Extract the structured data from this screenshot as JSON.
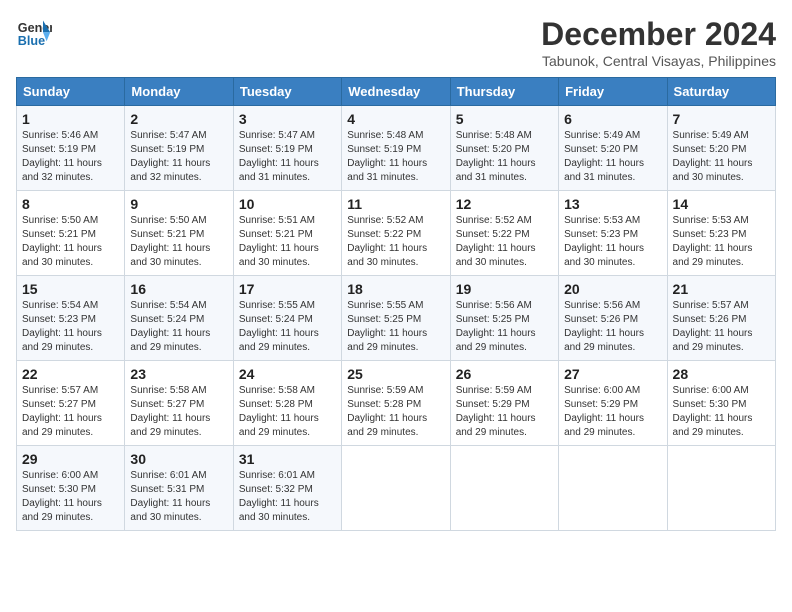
{
  "header": {
    "logo_line1": "General",
    "logo_line2": "Blue",
    "month": "December 2024",
    "location": "Tabunok, Central Visayas, Philippines"
  },
  "weekdays": [
    "Sunday",
    "Monday",
    "Tuesday",
    "Wednesday",
    "Thursday",
    "Friday",
    "Saturday"
  ],
  "weeks": [
    [
      {
        "day": "1",
        "info": "Sunrise: 5:46 AM\nSunset: 5:19 PM\nDaylight: 11 hours\nand 32 minutes."
      },
      {
        "day": "2",
        "info": "Sunrise: 5:47 AM\nSunset: 5:19 PM\nDaylight: 11 hours\nand 32 minutes."
      },
      {
        "day": "3",
        "info": "Sunrise: 5:47 AM\nSunset: 5:19 PM\nDaylight: 11 hours\nand 31 minutes."
      },
      {
        "day": "4",
        "info": "Sunrise: 5:48 AM\nSunset: 5:19 PM\nDaylight: 11 hours\nand 31 minutes."
      },
      {
        "day": "5",
        "info": "Sunrise: 5:48 AM\nSunset: 5:20 PM\nDaylight: 11 hours\nand 31 minutes."
      },
      {
        "day": "6",
        "info": "Sunrise: 5:49 AM\nSunset: 5:20 PM\nDaylight: 11 hours\nand 31 minutes."
      },
      {
        "day": "7",
        "info": "Sunrise: 5:49 AM\nSunset: 5:20 PM\nDaylight: 11 hours\nand 30 minutes."
      }
    ],
    [
      {
        "day": "8",
        "info": "Sunrise: 5:50 AM\nSunset: 5:21 PM\nDaylight: 11 hours\nand 30 minutes."
      },
      {
        "day": "9",
        "info": "Sunrise: 5:50 AM\nSunset: 5:21 PM\nDaylight: 11 hours\nand 30 minutes."
      },
      {
        "day": "10",
        "info": "Sunrise: 5:51 AM\nSunset: 5:21 PM\nDaylight: 11 hours\nand 30 minutes."
      },
      {
        "day": "11",
        "info": "Sunrise: 5:52 AM\nSunset: 5:22 PM\nDaylight: 11 hours\nand 30 minutes."
      },
      {
        "day": "12",
        "info": "Sunrise: 5:52 AM\nSunset: 5:22 PM\nDaylight: 11 hours\nand 30 minutes."
      },
      {
        "day": "13",
        "info": "Sunrise: 5:53 AM\nSunset: 5:23 PM\nDaylight: 11 hours\nand 30 minutes."
      },
      {
        "day": "14",
        "info": "Sunrise: 5:53 AM\nSunset: 5:23 PM\nDaylight: 11 hours\nand 29 minutes."
      }
    ],
    [
      {
        "day": "15",
        "info": "Sunrise: 5:54 AM\nSunset: 5:23 PM\nDaylight: 11 hours\nand 29 minutes."
      },
      {
        "day": "16",
        "info": "Sunrise: 5:54 AM\nSunset: 5:24 PM\nDaylight: 11 hours\nand 29 minutes."
      },
      {
        "day": "17",
        "info": "Sunrise: 5:55 AM\nSunset: 5:24 PM\nDaylight: 11 hours\nand 29 minutes."
      },
      {
        "day": "18",
        "info": "Sunrise: 5:55 AM\nSunset: 5:25 PM\nDaylight: 11 hours\nand 29 minutes."
      },
      {
        "day": "19",
        "info": "Sunrise: 5:56 AM\nSunset: 5:25 PM\nDaylight: 11 hours\nand 29 minutes."
      },
      {
        "day": "20",
        "info": "Sunrise: 5:56 AM\nSunset: 5:26 PM\nDaylight: 11 hours\nand 29 minutes."
      },
      {
        "day": "21",
        "info": "Sunrise: 5:57 AM\nSunset: 5:26 PM\nDaylight: 11 hours\nand 29 minutes."
      }
    ],
    [
      {
        "day": "22",
        "info": "Sunrise: 5:57 AM\nSunset: 5:27 PM\nDaylight: 11 hours\nand 29 minutes."
      },
      {
        "day": "23",
        "info": "Sunrise: 5:58 AM\nSunset: 5:27 PM\nDaylight: 11 hours\nand 29 minutes."
      },
      {
        "day": "24",
        "info": "Sunrise: 5:58 AM\nSunset: 5:28 PM\nDaylight: 11 hours\nand 29 minutes."
      },
      {
        "day": "25",
        "info": "Sunrise: 5:59 AM\nSunset: 5:28 PM\nDaylight: 11 hours\nand 29 minutes."
      },
      {
        "day": "26",
        "info": "Sunrise: 5:59 AM\nSunset: 5:29 PM\nDaylight: 11 hours\nand 29 minutes."
      },
      {
        "day": "27",
        "info": "Sunrise: 6:00 AM\nSunset: 5:29 PM\nDaylight: 11 hours\nand 29 minutes."
      },
      {
        "day": "28",
        "info": "Sunrise: 6:00 AM\nSunset: 5:30 PM\nDaylight: 11 hours\nand 29 minutes."
      }
    ],
    [
      {
        "day": "29",
        "info": "Sunrise: 6:00 AM\nSunset: 5:30 PM\nDaylight: 11 hours\nand 29 minutes."
      },
      {
        "day": "30",
        "info": "Sunrise: 6:01 AM\nSunset: 5:31 PM\nDaylight: 11 hours\nand 30 minutes."
      },
      {
        "day": "31",
        "info": "Sunrise: 6:01 AM\nSunset: 5:32 PM\nDaylight: 11 hours\nand 30 minutes."
      },
      {
        "day": "",
        "info": ""
      },
      {
        "day": "",
        "info": ""
      },
      {
        "day": "",
        "info": ""
      },
      {
        "day": "",
        "info": ""
      }
    ]
  ]
}
